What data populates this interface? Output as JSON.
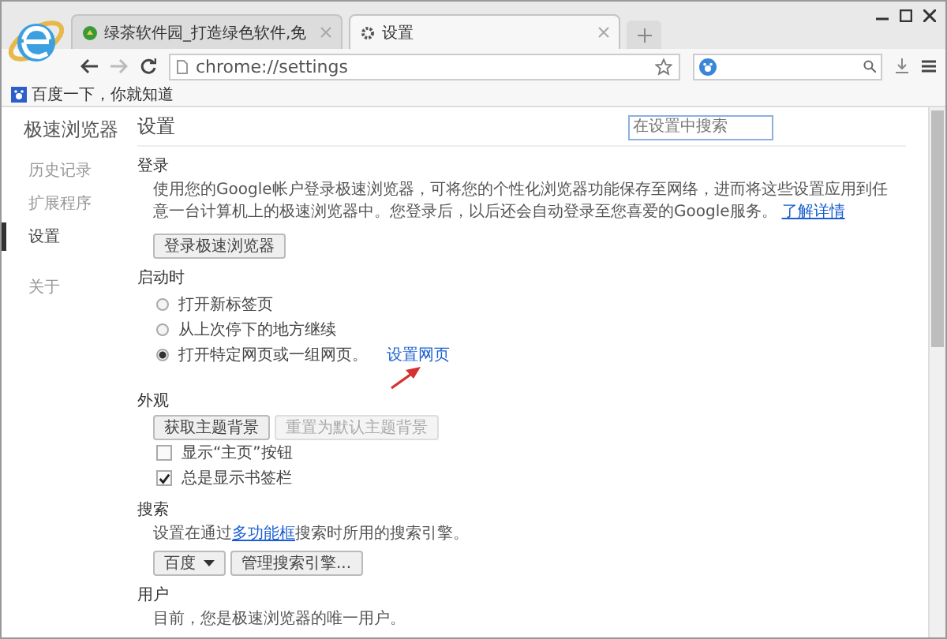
{
  "window": {
    "tabs": [
      {
        "title": "绿茶软件园_打造绿色软件,免",
        "selected": false,
        "kind": "web"
      },
      {
        "title": "设置",
        "selected": true,
        "kind": "settings"
      }
    ]
  },
  "toolbar": {
    "address": "chrome://settings"
  },
  "bookmarks": [
    {
      "label": "百度一下，你就知道"
    }
  ],
  "sidebar": {
    "title": "极速浏览器",
    "items": [
      {
        "label": "历史记录",
        "selected": false
      },
      {
        "label": "扩展程序",
        "selected": false
      },
      {
        "label": "设置",
        "selected": true
      },
      {
        "label": "关于",
        "selected": false
      }
    ]
  },
  "page": {
    "title": "设置",
    "search": {
      "placeholder": "在设置中搜索"
    }
  },
  "sections": [
    {
      "kind": "signin",
      "title": "登录",
      "text": "使用您的Google帐户登录极速浏览器，可将您的个性化浏览器功能保存至网络，进而将这些设置应用到任意一台计算机上的极速浏览器中。您登录后，以后还会自动登录至您喜爱的Google服务。",
      "link": "了解详情",
      "button": "登录极速浏览器"
    },
    {
      "kind": "startup",
      "title": "启动时",
      "options": [
        {
          "label": "打开新标签页",
          "selected": false
        },
        {
          "label": "从上次停下的地方继续",
          "selected": false
        },
        {
          "label": "打开特定网页或一组网页。",
          "selected": true,
          "link": "设置网页"
        }
      ]
    },
    {
      "kind": "appearance",
      "title": "外观",
      "buttons": [
        {
          "label": "获取主题背景",
          "disabled": false
        },
        {
          "label": "重置为默认主题背景",
          "disabled": true
        }
      ],
      "checks": [
        {
          "label": "显示“主页”按钮",
          "checked": false
        },
        {
          "label": "总是显示书签栏",
          "checked": true
        }
      ]
    },
    {
      "kind": "search",
      "title": "搜索",
      "before": "设置在通过",
      "link": "多功能框",
      "after": "搜索时所用的搜索引擎。",
      "engine": "百度",
      "button": "管理搜索引擎..."
    },
    {
      "kind": "users",
      "title": "用户",
      "text": "目前，您是极速浏览器的唯一用户。"
    }
  ]
}
